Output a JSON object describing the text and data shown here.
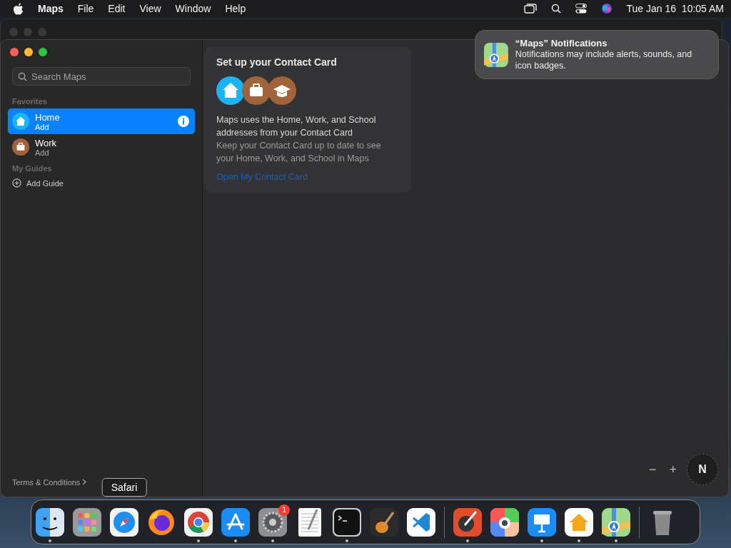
{
  "menu_bar": {
    "app": "Maps",
    "menus": [
      "File",
      "Edit",
      "View",
      "Window",
      "Help"
    ],
    "clock": "Tue Jan 16  10:05 AM"
  },
  "sidebar": {
    "search": {
      "placeholder": "Search Maps"
    },
    "sections": [
      {
        "title": "Favorites",
        "items": [
          {
            "kind": "home",
            "title": "Home",
            "subtitle": "Add",
            "selected": true
          },
          {
            "kind": "work",
            "title": "Work",
            "subtitle": "Add",
            "selected": false
          }
        ]
      },
      {
        "title": "My Guides",
        "items": [
          {
            "kind": "add",
            "title": "Add Guide",
            "selected": false
          }
        ]
      }
    ],
    "footer_link": "Terms & Conditions"
  },
  "contact_card": {
    "title": "Set up your Contact Card",
    "icons": [
      {
        "kind": "home"
      },
      {
        "kind": "work"
      },
      {
        "kind": "school"
      }
    ],
    "body": "Maps uses the Home, Work, and School addresses from your Contact Card",
    "hint": "Keep your Contact Card up to date to see your Home, Work, and School in Maps",
    "link": "Open My Contact Card"
  },
  "map_controls": {
    "zoom_out": "−",
    "zoom_in": "+",
    "compass": "N"
  },
  "notification": {
    "title": "“Maps” Notifications",
    "body": "Notifications may include alerts, sounds, and icon badges."
  },
  "dock": {
    "groups": [
      [
        {
          "kind": "finder",
          "running": true
        },
        {
          "kind": "launchpad",
          "running": false
        },
        {
          "kind": "safari",
          "running": false,
          "tooltip": "Safari"
        },
        {
          "kind": "firefox",
          "running": false
        },
        {
          "kind": "chrome",
          "running": true
        },
        {
          "kind": "appstore",
          "running": true
        },
        {
          "kind": "settings",
          "running": true,
          "badge": "1"
        },
        {
          "kind": "textedit",
          "running": false
        },
        {
          "kind": "terminal",
          "running": true
        },
        {
          "kind": "garageband",
          "running": false
        },
        {
          "kind": "vscode",
          "running": false
        }
      ],
      [
        {
          "kind": "colorpicker",
          "running": true
        },
        {
          "kind": "colorsync",
          "running": false
        },
        {
          "kind": "keynote",
          "running": true
        },
        {
          "kind": "home",
          "running": true
        },
        {
          "kind": "maps",
          "running": true
        }
      ],
      [
        {
          "kind": "trash",
          "running": false
        }
      ]
    ]
  }
}
